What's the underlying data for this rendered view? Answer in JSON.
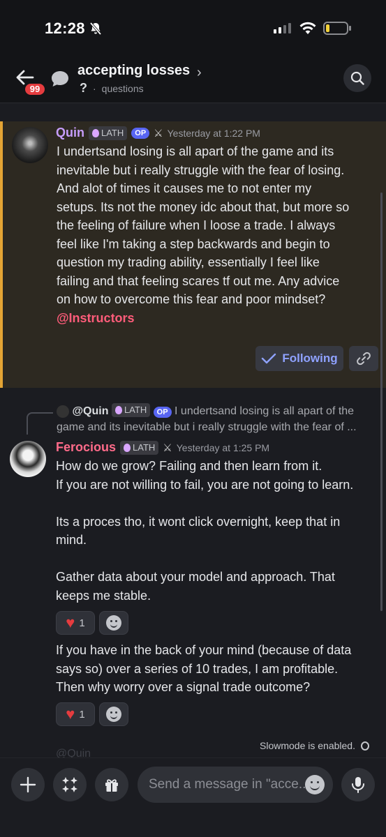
{
  "status_bar": {
    "time": "12:28"
  },
  "header": {
    "unread_badge": "99",
    "thread_title": "accepting losses",
    "subtitle_icon": "?",
    "subtitle": "questions"
  },
  "op_message": {
    "author": "Quin",
    "role": "LATH",
    "op_tag": "OP",
    "timestamp": "Yesterday at 1:22 PM",
    "lines": [
      "I undertsand losing is all apart of the game and its",
      "inevitable but i really struggle with the fear of losing.",
      "And alot of times it causes me to not enter my",
      "setups. Its not the money idc about that, but more so",
      "the feeling of failure when I loose a trade. I always",
      "feel like I'm taking a step backwards and begin to",
      "question my trading ability, essentially I feel like",
      "failing and that feeling scares tf out me. Any advice",
      "on how to overcome this fear and poor mindset?"
    ],
    "mention": "@Instructors",
    "following_label": "Following"
  },
  "reply": {
    "preview_author": "@Quin",
    "preview_role": "LATH",
    "preview_op": "OP",
    "preview_text_1": "I undertsand losing is all apart of the",
    "preview_text_2": "game and its inevitable but i really struggle with the fear of ...",
    "author": "Ferocious",
    "role": "LATH",
    "timestamp": "Yesterday at 1:25 PM",
    "block1": [
      "How do we grow? Failing and then learn from it.",
      "If you are not willing to fail, you are not going to learn.",
      "",
      "Its a proces tho, it wont click overnight, keep that in",
      "mind.",
      "",
      "Gather data about your model and approach. That",
      "keeps me stable."
    ],
    "reaction1_count": "1",
    "block2": [
      "If you have in the back of your mind (because of data",
      "says so) over a series of 10 trades, I am profitable.",
      "Then why worry over a signal trade outcome?"
    ],
    "reaction2_count": "1"
  },
  "faded_next": "@Quin",
  "slowmode": "Slowmode is enabled.",
  "composer": {
    "placeholder": "Send a message in \"acce.."
  }
}
